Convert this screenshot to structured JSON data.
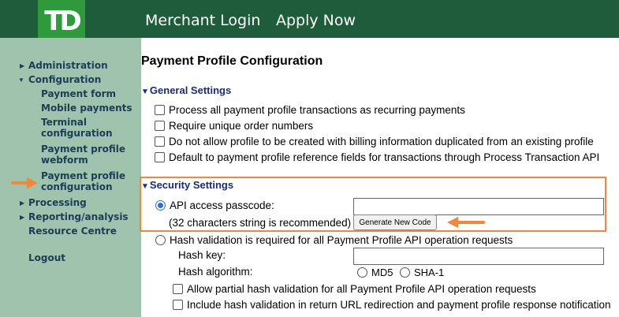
{
  "header": {
    "logo_text": "TD",
    "nav": [
      "Merchant Login",
      "Apply Now"
    ]
  },
  "sidebar": {
    "items": [
      {
        "label": "Administration",
        "icon": "triangle-right-icon"
      },
      {
        "label": "Configuration",
        "icon": "triangle-down-icon"
      },
      {
        "label": "Payment form"
      },
      {
        "label": "Mobile payments"
      },
      {
        "label": "Terminal configuration"
      },
      {
        "label": "Payment profile webform"
      },
      {
        "label": "Payment profile configuration"
      },
      {
        "label": "Processing",
        "icon": "triangle-right-icon"
      },
      {
        "label": "Reporting/analysis",
        "icon": "triangle-right-icon"
      },
      {
        "label": "Resource Centre"
      },
      {
        "label": "Logout"
      }
    ]
  },
  "main": {
    "title": "Payment Profile Configuration",
    "general": {
      "title": "General Settings",
      "options": [
        "Process all payment profile transactions as recurring payments",
        "Require unique order numbers",
        "Do not allow profile to be created with billing information duplicated from an existing profile",
        "Default to payment profile reference fields for transactions through Process Transaction API"
      ]
    },
    "security": {
      "title": "Security Settings",
      "api_label": "API access passcode:",
      "api_value": "",
      "api_hint": "(32 characters string is recommended)",
      "generate_button": "Generate New Code",
      "hash_label": "Hash validation is required for all Payment Profile API operation requests",
      "hash_key_label": "Hash key:",
      "hash_key_value": "",
      "hash_algo_label": "Hash algorithm:",
      "algo_options": [
        "MD5",
        "SHA-1"
      ],
      "partial_label": "Allow partial hash validation for all Payment Profile API operation requests",
      "include_label": "Include hash validation in return URL redirection and payment profile response notification"
    }
  },
  "colors": {
    "header": "#1f5c3b",
    "logo": "#2f9a3c",
    "sidebar": "#9fc3ad",
    "accent": "#f0873c"
  }
}
